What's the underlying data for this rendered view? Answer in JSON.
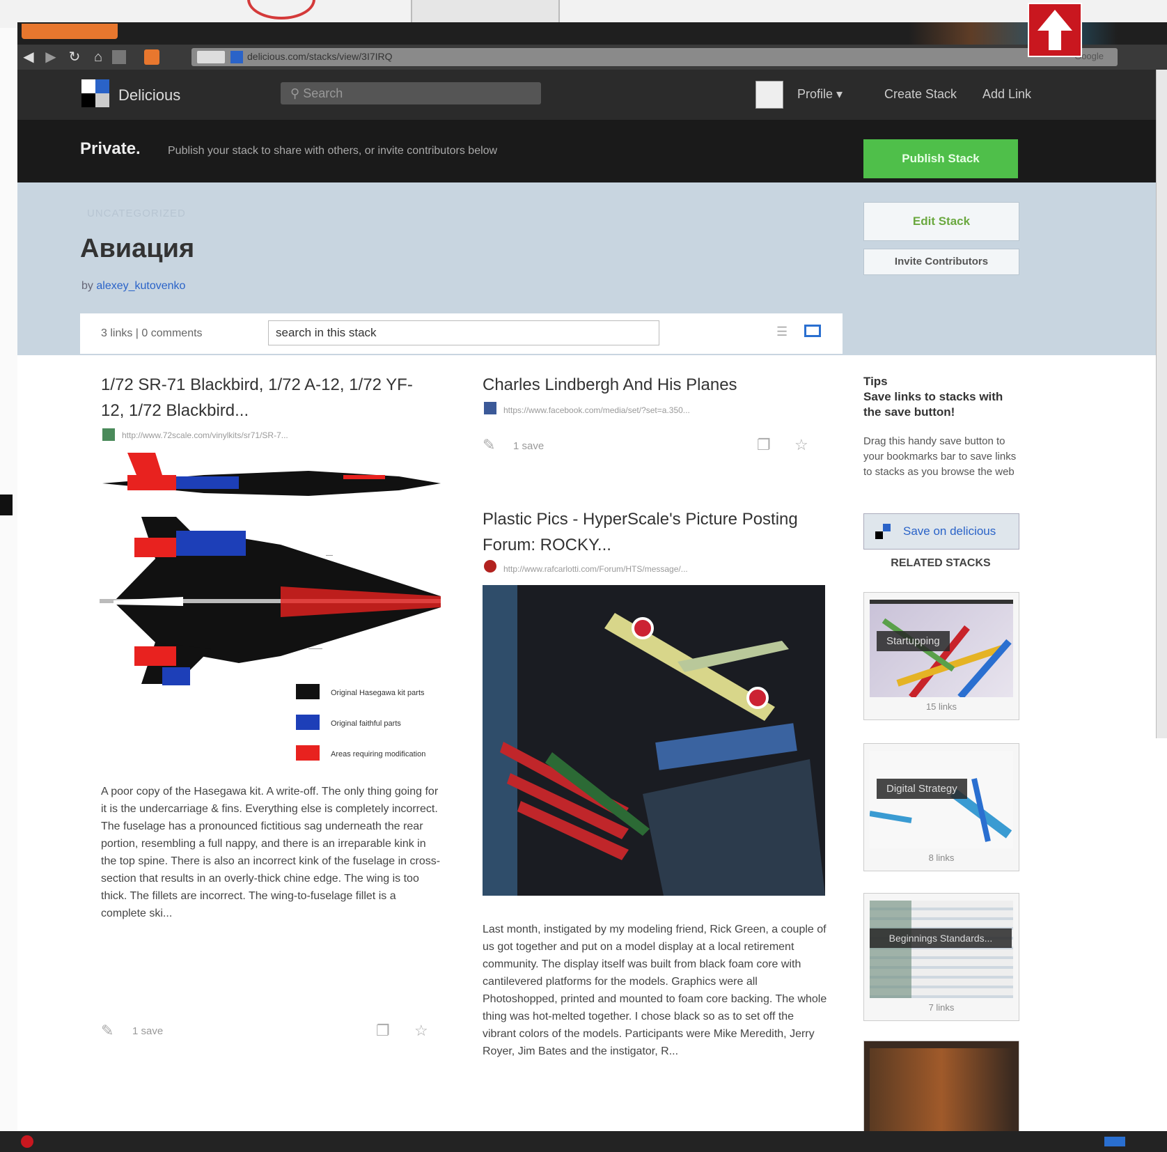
{
  "browser": {
    "url": "delicious.com/stacks/view/3I7IRQ",
    "search_engine": "Google",
    "ff_button": "Firefox"
  },
  "site": {
    "brand": "Delicious",
    "search_placeholder": "Search",
    "profile_label": "Profile ▾",
    "create_stack": "Create Stack",
    "add_link": "Add Link"
  },
  "private_bar": {
    "label": "Private.",
    "text": "Publish your stack to share with others, or invite contributors below",
    "publish_button": "Publish Stack"
  },
  "stack": {
    "meta_label": "UNCATEGORIZED",
    "title": "Авиация",
    "by_prefix": "by",
    "author": "alexey_kutovenko",
    "edit_button": "Edit Stack",
    "invite_button": "Invite Contributors",
    "counts": "3 links  |  0 comments",
    "search_value": "search in this stack"
  },
  "cards": [
    {
      "title": "1/72 SR-71 Blackbird, 1/72 A-12, 1/72 YF-12, 1/72 Blackbird...",
      "url": "http://www.72scale.com/vinylkits/sr71/SR-7...",
      "body": "A poor copy of the Hasegawa kit. A write-off. The only thing going for it is the undercarriage & fins. Everything else is completely incorrect. The fuselage has a pronounced fictitious sag underneath the rear portion, resembling a full nappy, and there is an irreparable kink in the top spine. There is also an incorrect kink of the fuselage in cross-section that results in an overly-thick chine edge. The wing is too thick. The fillets are incorrect. The wing-to-fuselage fillet is a complete ski...",
      "saves": "1 save",
      "legend": [
        "Original Hasegawa kit parts",
        "Original faithful parts",
        "Areas requiring modification"
      ]
    },
    {
      "title": "Charles Lindbergh And His Planes",
      "url": "https://www.facebook.com/media/set/?set=a.350...",
      "saves": "1 save"
    },
    {
      "title": "Plastic Pics - HyperScale's Picture Posting Forum: ROCKY...",
      "url": "http://www.rafcarlotti.com/Forum/HTS/message/...",
      "body": "Last month, instigated by my modeling friend, Rick Green, a couple of us got together and put on a model display at a local retirement community. The display itself was built from black foam core with cantilevered platforms for the models. Graphics were all Photoshopped, printed and mounted to foam core backing. The whole thing was hot-melted together. I chose black so as to set off the vibrant colors of the models. Participants were Mike Meredith, Jerry Royer, Jim Bates and the instigator, R..."
    }
  ],
  "sidebar": {
    "tips_title": "Tips",
    "tips_headline": "Save links to stacks with the save button!",
    "tips_body": "Drag this handy save button to your bookmarks bar to save links to stacks as you browse the web",
    "save_button": "Save on delicious",
    "related_title": "RELATED STACKS",
    "related": [
      {
        "label": "Startupping",
        "count": "15 links"
      },
      {
        "label": "Digital Strategy",
        "count": "8 links"
      },
      {
        "label": "Beginnings Standards...",
        "count": "7 links"
      }
    ]
  },
  "colors": {
    "accent_green": "#4fbf4a",
    "link_blue": "#2a63c8",
    "header_dark": "#2b2b2b",
    "stack_header_bg": "#c8d5e0"
  }
}
